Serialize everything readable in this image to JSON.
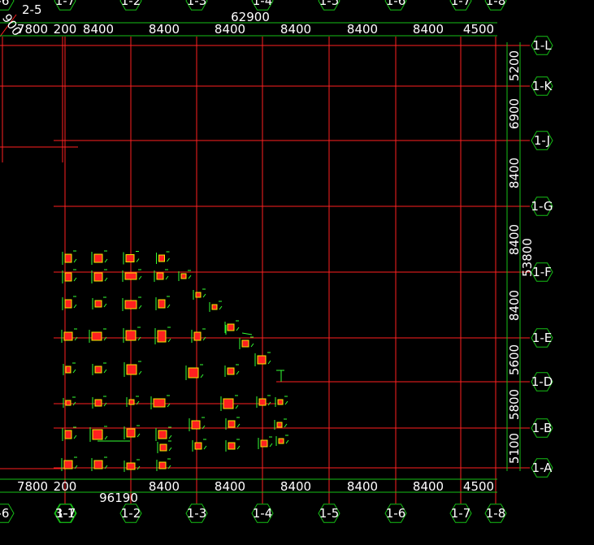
{
  "drawing": {
    "background": "#000000",
    "grid_color": "#ff2020",
    "dim_color": "#16c016",
    "text_color": "#ffffff",
    "column_fill": "#ff2020",
    "column_outline": "#f0f000",
    "column_tag": "#33ff33"
  },
  "x_axes": [
    "-6",
    "1-7",
    "1-2",
    "1-3",
    "1-4",
    "1-5",
    "1-6",
    "1-7",
    "1-8"
  ],
  "x_axes_bottom_left": [
    "-6",
    "3-1",
    "1-7"
  ],
  "y_axes": [
    "1-L",
    "1-K",
    "1-J",
    "1-G",
    "1-F",
    "1-E",
    "1-D",
    "1-B",
    "1-A"
  ],
  "top_labels": {
    "corner_axis": "2-5",
    "corner_dim_fragment": "900",
    "overall_dim": "62900",
    "spans": [
      "7800",
      "200",
      "8400",
      "8400",
      "8400",
      "8400",
      "8400",
      "8400",
      "4500"
    ]
  },
  "bottom_labels": {
    "overall_dim": "96190",
    "spans": [
      "7800",
      "200",
      "8400",
      "8400",
      "8400",
      "8400",
      "8400",
      "4500"
    ]
  },
  "right_labels": {
    "overall_dim": "53800",
    "spans": [
      "5200",
      "6900",
      "8400",
      "8400",
      "8400",
      "5600",
      "5800",
      "5100"
    ]
  }
}
